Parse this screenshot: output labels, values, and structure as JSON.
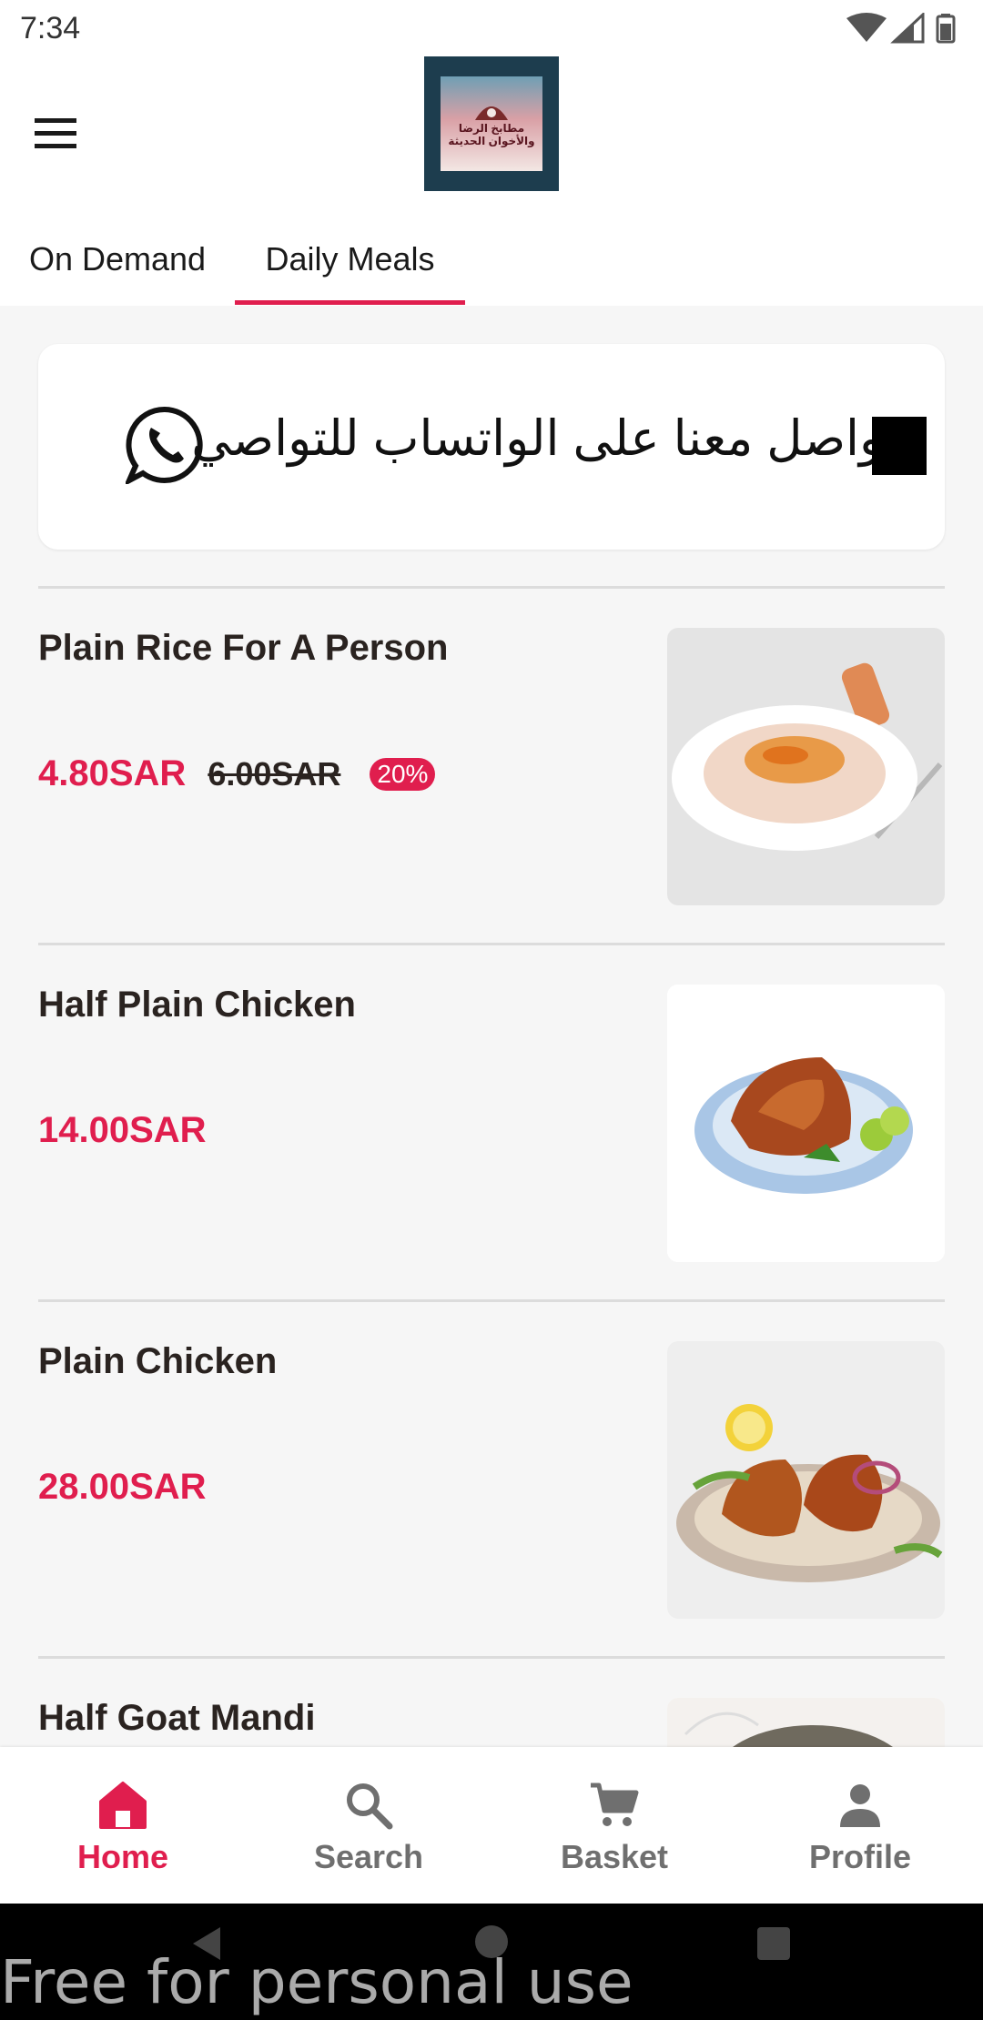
{
  "status_bar": {
    "time": "7:34"
  },
  "header": {
    "logo_text_line1": "مطابخ الرضا",
    "logo_text_line2": "والأخوان الحديثة"
  },
  "tabs": [
    {
      "label": "On Demand",
      "selected": false
    },
    {
      "label": "Daily Meals",
      "selected": true
    }
  ],
  "whatsapp_banner": {
    "text": "تواصل معنا على الواتساب للتواصي"
  },
  "meals": [
    {
      "name": "Plain Rice For A Person",
      "price": "4.80SAR",
      "old_price": "6.00SAR",
      "discount": "20%"
    },
    {
      "name": "Half Plain Chicken",
      "price": "14.00SAR"
    },
    {
      "name": "Plain Chicken",
      "price": "28.00SAR"
    },
    {
      "name": "Half Goat Mandi"
    }
  ],
  "bottom_nav": [
    {
      "label": "Home",
      "icon": "home-icon",
      "active": true
    },
    {
      "label": "Search",
      "icon": "search-icon",
      "active": false
    },
    {
      "label": "Basket",
      "icon": "cart-icon",
      "active": false
    },
    {
      "label": "Profile",
      "icon": "person-icon",
      "active": false
    }
  ],
  "watermark": "Free for personal use",
  "colors": {
    "accent": "#e01e4e",
    "text": "#2a2320",
    "nav_inactive": "#6f6f6f"
  }
}
